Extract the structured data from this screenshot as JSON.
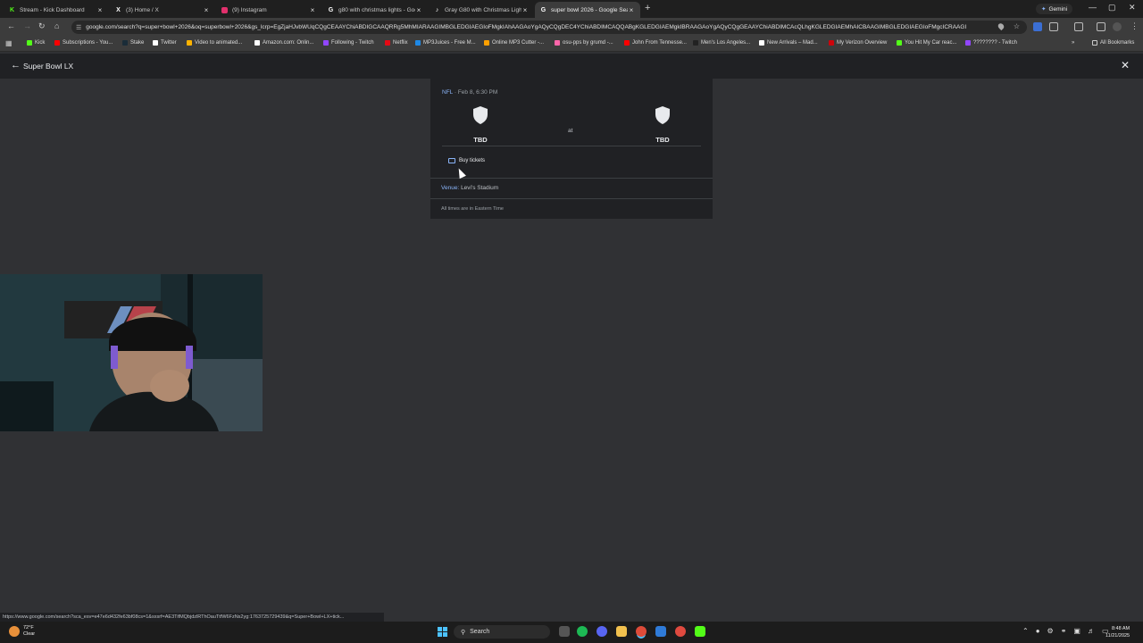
{
  "browser": {
    "tabs": [
      {
        "title": "Stream - Kick Dashboard",
        "favicon_color": "#53fc18",
        "glyph": "K"
      },
      {
        "title": "(3) Home / X",
        "favicon_color": "#ffffff",
        "glyph": "X"
      },
      {
        "title": "(9) Instagram",
        "favicon_color": "#e1306c",
        "glyph": ""
      },
      {
        "title": "g80 with christmas lights - Goo",
        "favicon_color": "#ffffff",
        "glyph": "G"
      },
      {
        "title": "Gray G80 with Christmas Lights",
        "favicon_color": "#ffffff",
        "glyph": "♪"
      },
      {
        "title": "super bowl 2026 - Google Sear",
        "favicon_color": "#ffffff",
        "glyph": "G"
      }
    ],
    "active_tab_index": 5,
    "gemini_label": "Gemini",
    "url": "google.com/search?q=super+bowl+2026&oq=superbowl+2026&gs_lcrp=EgZjaHJvbWUqCQgCEAAYChiABDIGCAAQRRg5MhMIARAAGIMBGLEDGIAEGIoFMgkIAhAAGAoYgAQyCQgDEC4YChiABDIMCAQQABgKGLEDGIAEMgkIBRAAGAoYgAQyCQgGEAAYChiABDIMCAcQLhgKGLEDGIAEMhAICBAAGIMBGLEDGIAEGIoFMgcICRAAGI",
    "bookmarks": [
      {
        "label": "Kick",
        "color": "#53fc18"
      },
      {
        "label": "Subscriptions - You...",
        "color": "#ff0000"
      },
      {
        "label": "Stake",
        "color": "#1a2c38"
      },
      {
        "label": "Twitter",
        "color": "#ffffff"
      },
      {
        "label": "Video to animated...",
        "color": "#ffb300"
      },
      {
        "label": "Amazon.com: Onlin...",
        "color": "#ffffff"
      },
      {
        "label": "Following - Twitch",
        "color": "#9146ff"
      },
      {
        "label": "Netflix",
        "color": "#e50914"
      },
      {
        "label": "MP3Juices - Free M...",
        "color": "#1e88e5"
      },
      {
        "label": "Online MP3 Cutter -...",
        "color": "#ffa000"
      },
      {
        "label": "osu-pps by grumd -...",
        "color": "#ff66aa"
      },
      {
        "label": "John From Tennesse...",
        "color": "#ff0000"
      },
      {
        "label": "Men's Los Angeles...",
        "color": "#222222"
      },
      {
        "label": "New Arrivals – Mad...",
        "color": "#ffffff"
      },
      {
        "label": "My Verizon Overview",
        "color": "#cd040b"
      },
      {
        "label": "You Hit My Car reac...",
        "color": "#53fc18"
      },
      {
        "label": "???????? - Twitch",
        "color": "#9146ff"
      }
    ],
    "all_bookmarks_label": "All Bookmarks"
  },
  "header": {
    "title": "Super Bowl LX"
  },
  "game": {
    "league": "NFL",
    "datetime": "· Feb 8, 6:30 PM",
    "away_team": "TBD",
    "home_team": "TBD",
    "at": "at",
    "buy_tickets": "Buy tickets",
    "venue_label": "Venue:",
    "venue_value": "Levi's Stadium",
    "timezone_note": "All times are in Eastern Time"
  },
  "status_url": "https://www.google.com/search?sca_esv=e47e6d432fe63bf08cs=1&sxsrf=AE3TifMQbjdzlRThOauTtfW6FzNs2yg:1763725729439&q=Super+Bowl+LX+tick...",
  "taskbar": {
    "weather_temp": "72°F",
    "weather_desc": "Clear",
    "search_placeholder": "Search",
    "time": "8:48 AM",
    "date": "11/21/2025"
  }
}
